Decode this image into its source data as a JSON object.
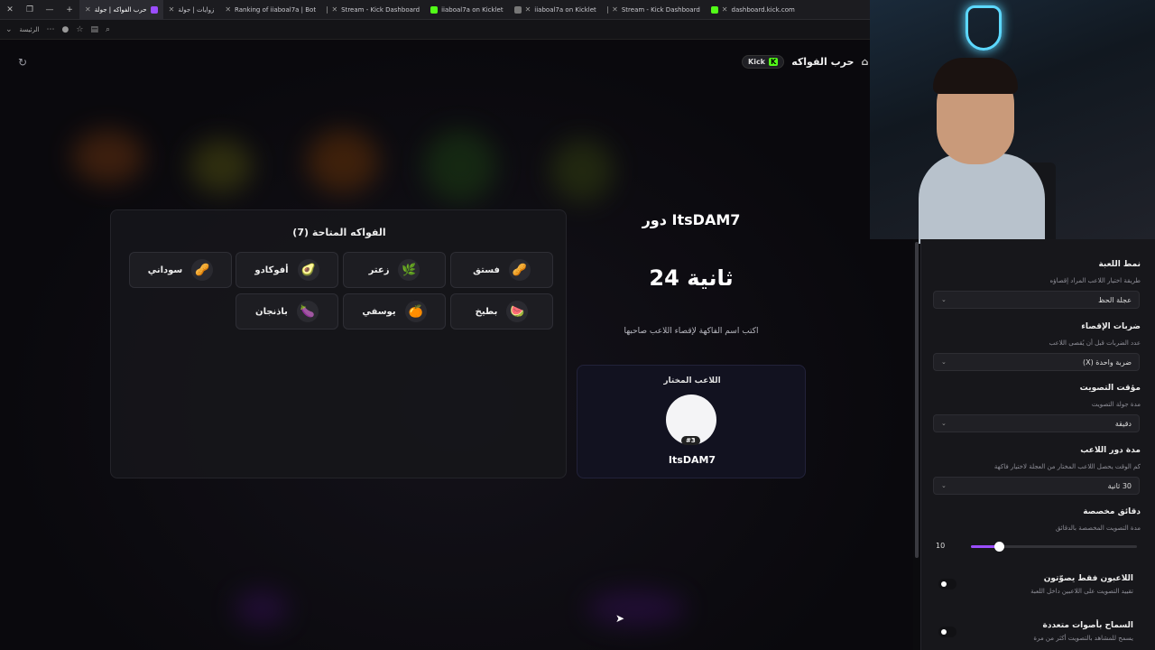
{
  "browser": {
    "tabs": [
      {
        "label": "حرب الفواكه | جولة",
        "active": true,
        "color": "#9b4dff"
      },
      {
        "label": "زوايات | جولة",
        "active": false,
        "color": "#555"
      },
      {
        "label": "Ranking of iiaboal7a | Bot",
        "active": false,
        "color": "#555"
      },
      {
        "label": "Stream - Kick Dashboard",
        "active": false,
        "color": "#53fc18"
      },
      {
        "label": "iiaboal7a on Kicklet",
        "active": false,
        "color": "#777"
      },
      {
        "label": "iiaboal7a on Kicklet",
        "active": false,
        "color": "#777"
      },
      {
        "label": "Stream - Kick Dashboard",
        "active": false,
        "color": "#53fc18"
      },
      {
        "label": "dashboard.kick.com",
        "active": false,
        "color": "#53fc18"
      }
    ],
    "address_label": "الرئيسة"
  },
  "header": {
    "title": "حرب الفواكه",
    "kick_badge": "Kick",
    "kick_letter": "K"
  },
  "fruits": {
    "title": "الفواكه المتاحة (7)",
    "items": [
      {
        "label": "فستق",
        "emoji": "🥜"
      },
      {
        "label": "زعتر",
        "emoji": "🌿"
      },
      {
        "label": "أفوكادو",
        "emoji": "🥑"
      },
      {
        "label": "سوداني",
        "emoji": "🥜"
      },
      {
        "label": "بطيخ",
        "emoji": "🍉"
      },
      {
        "label": "يوسفي",
        "emoji": "🍊"
      },
      {
        "label": "باذنجان",
        "emoji": "🍆"
      }
    ]
  },
  "turn": {
    "title": "دور ItsDAM7",
    "timer": "24 ثانية",
    "hint": "اكتب اسم الفاكهة لإقصاء اللاعب صاحبها"
  },
  "player": {
    "label": "اللاعب المختار",
    "rank": "#3",
    "name": "ItsDAM7"
  },
  "settings": {
    "mode": {
      "title": "نمط اللعبة",
      "sub": "طريقة اختيار اللاعب المراد إقصاؤه",
      "value": "عجلة الحظ"
    },
    "hits": {
      "title": "ضربات الإقصاء",
      "sub": "عدد الضربات قبل أن يُقصى اللاعب",
      "value": "ضربة واحدة (X)"
    },
    "vote_timer": {
      "title": "مؤقت التصويت",
      "sub": "مدة جولة التصويت",
      "value": "دقيقة"
    },
    "turn_duration": {
      "title": "مدة دور اللاعب",
      "sub": "كم الوقت يحصل اللاعب المختار من العجلة لاختيار فاكهة",
      "value": "30 ثانية"
    },
    "custom_minutes": {
      "title": "دقائق مخصصة",
      "sub": "مدة التصويت المخصصة بالدقائق",
      "value": "10",
      "slider_fraction": 0.17
    },
    "players_only": {
      "title": "اللاعبون فقط يصوّتون",
      "sub": "تقييد التصويت على اللاعبين داخل اللعبة"
    },
    "multi_votes": {
      "title": "السماح بأصوات متعددة",
      "sub": "يسمح للمشاهد بالتصويت أكثر من مرة"
    }
  },
  "colors": {
    "accent": "#9b4dff",
    "kick": "#53fc18"
  }
}
